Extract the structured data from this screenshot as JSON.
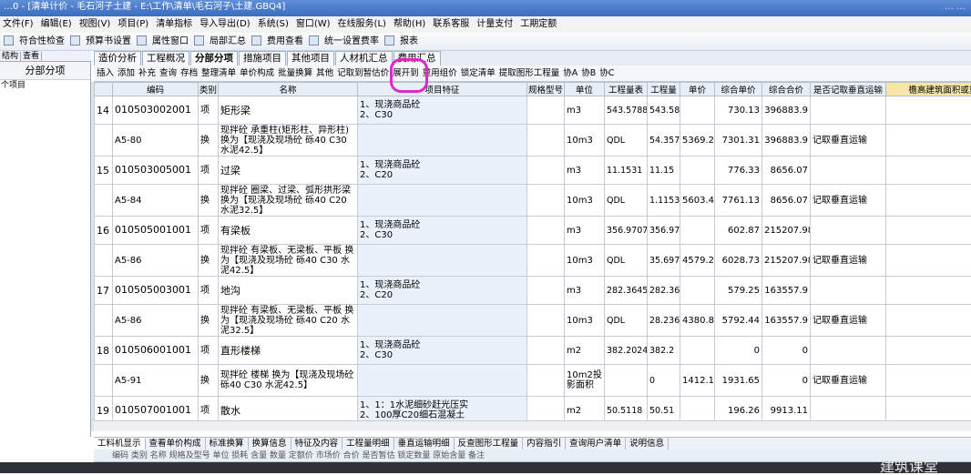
{
  "window": {
    "title": "…0 - [清单计价 - 毛石河子土建 - E:\\工作\\清单\\毛石河子\\土建.GBQ4]",
    "title_right": "…  …"
  },
  "menu": [
    "文件(F)",
    "编辑(E)",
    "视图(V)",
    "项目(P)",
    "清单指标",
    "导入导出(D)",
    "系统(S)",
    "窗口(W)",
    "在线服务(L)",
    "帮助(H)",
    "联系客服",
    "计量支付",
    "工期定额"
  ],
  "toolbar": [
    "符合性检查",
    "预算书设置",
    "属性窗口",
    "局部汇总",
    "费用查看",
    "统一设置费率",
    "报表"
  ],
  "left_tabs": [
    "结构",
    "查看"
  ],
  "left_panel": {
    "header": "分部分项",
    "item": "个项目"
  },
  "tabs": [
    "造价分析",
    "工程概况",
    "分部分项",
    "措施项目",
    "其他项目",
    "人材机汇总",
    "费用汇总"
  ],
  "active_tab": 2,
  "subtool": [
    "插入",
    "添加",
    "补充",
    "查询",
    "存档",
    "整理清单",
    "单价构成",
    "批量换算",
    "其他",
    "记取到暂估价",
    "展开到",
    "重用组价",
    "锁定清单",
    "提取图形工程量",
    "协A",
    "协B",
    "协C"
  ],
  "columns": [
    "",
    "编码",
    "类别",
    "名称",
    "项目特征",
    "规格型号",
    "单位",
    "工程量表",
    "工程量",
    "单价",
    "综合单价",
    "综合合价",
    "是否记取垂直运输",
    "檐高建筑面积或重(t)"
  ],
  "rows": [
    {
      "no": "14",
      "code": "010503002001",
      "type": "项",
      "name": "矩形梁",
      "feature": "1、现浇商品砼\n2、C30",
      "unit": "m3",
      "qty_expr": "543.5788",
      "qty": "543.58",
      "price": "",
      "unit_price": "730.13",
      "total": "396883.9",
      "vert": "",
      "kind": "item"
    },
    {
      "no": "",
      "code": "A5-80",
      "type": "换",
      "name": "现拌砼 承重柱(矩形柱、异形柱) 换为【现浇及现场砼 砾40 C30 水泥42.5】",
      "feature": "",
      "unit": "10m3",
      "qty_expr": "QDL",
      "qty": "54.35788",
      "price": "5369.22",
      "unit_price": "7301.31",
      "total": "396883.9",
      "vert": "记取垂直运输",
      "kind": "sub"
    },
    {
      "no": "15",
      "code": "010503005001",
      "type": "项",
      "name": "过梁",
      "feature": "1、现浇商品砼\n2、C20",
      "unit": "m3",
      "qty_expr": "11.1531",
      "qty": "11.15",
      "price": "",
      "unit_price": "776.33",
      "total": "8656.07",
      "vert": "",
      "kind": "item"
    },
    {
      "no": "",
      "code": "A5-84",
      "type": "换",
      "name": "现拌砼 圈梁、过梁、弧形拱形梁 换为【现浇及现场砼 砾40 C20 水泥32.5】",
      "feature": "",
      "unit": "10m3",
      "qty_expr": "QDL",
      "qty": "1.11531",
      "price": "5603.48",
      "unit_price": "7761.13",
      "total": "8656.07",
      "vert": "记取垂直运输",
      "kind": "sub"
    },
    {
      "no": "16",
      "code": "010505001001",
      "type": "项",
      "name": "有梁板",
      "feature": "1、现浇商品砼\n2、C30",
      "unit": "m3",
      "qty_expr": "356.9707",
      "qty": "356.97",
      "price": "",
      "unit_price": "602.87",
      "total": "215207.98",
      "vert": "",
      "kind": "item"
    },
    {
      "no": "",
      "code": "A5-86",
      "type": "换",
      "name": "现拌砼 有梁板、无梁板、平板 换为【现浇及现场砼 砾40 C30 水泥42.5】",
      "feature": "",
      "unit": "10m3",
      "qty_expr": "QDL",
      "qty": "35.69707",
      "price": "4579.29",
      "unit_price": "6028.73",
      "total": "215207.98",
      "vert": "记取垂直运输",
      "kind": "sub"
    },
    {
      "no": "17",
      "code": "010505003001",
      "type": "项",
      "name": "地沟",
      "feature": "1、现浇商品砼\n2、C20",
      "unit": "m3",
      "qty_expr": "282.3645",
      "qty": "282.36",
      "price": "",
      "unit_price": "579.25",
      "total": "163557.9",
      "vert": "",
      "kind": "item"
    },
    {
      "no": "",
      "code": "A5-86",
      "type": "换",
      "name": "现拌砼 有梁板、无梁板、平板 换为【现浇及现场砼 砾40 C20 水泥32.5】",
      "feature": "",
      "unit": "10m3",
      "qty_expr": "QDL",
      "qty": "28.23645",
      "price": "4380.86",
      "unit_price": "5792.44",
      "total": "163557.9",
      "vert": "记取垂直运输",
      "kind": "sub"
    },
    {
      "no": "18",
      "code": "010506001001",
      "type": "项",
      "name": "直形楼梯",
      "feature": "1、现浇商品砼\n2、C30",
      "unit": "m2",
      "qty_expr": "382.2024",
      "qty": "382.2",
      "price": "",
      "unit_price": "0",
      "total": "0",
      "vert": "",
      "kind": "item"
    },
    {
      "no": "",
      "code": "A5-91",
      "type": "换",
      "name": "现拌砼 楼梯 换为【现浇及现场砼 砾40 C30 水泥42.5】",
      "feature": "",
      "unit": "10m2投影面积",
      "qty_expr": "",
      "qty": "0",
      "price": "1412.15",
      "unit_price": "1931.65",
      "total": "0",
      "vert": "记取垂直运输",
      "kind": "sub"
    },
    {
      "no": "19",
      "code": "010507001001",
      "type": "项",
      "name": "散水",
      "feature": "1、1：1水泥细砂赶光压实\n2、100厚C20细石混凝土",
      "unit": "m2",
      "qty_expr": "50.5118",
      "qty": "50.51",
      "price": "",
      "unit_price": "196.26",
      "total": "9913.11",
      "vert": "",
      "kind": "item"
    }
  ],
  "bottom_tabs": [
    "工料机显示",
    "查看单价构成",
    "标准换算",
    "换算信息",
    "特征及内容",
    "工程量明细",
    "垂直运输明细",
    "反查图形工程量",
    "内容指引",
    "查询用户清单",
    "说明信息"
  ],
  "bottom_header": "编码 类别 名称 规格及型号 单位 损耗 含量 数量 定额价 市场价 合价 是否暂估 锁定数量 原始含量 备注",
  "watermark": "建筑课堂"
}
